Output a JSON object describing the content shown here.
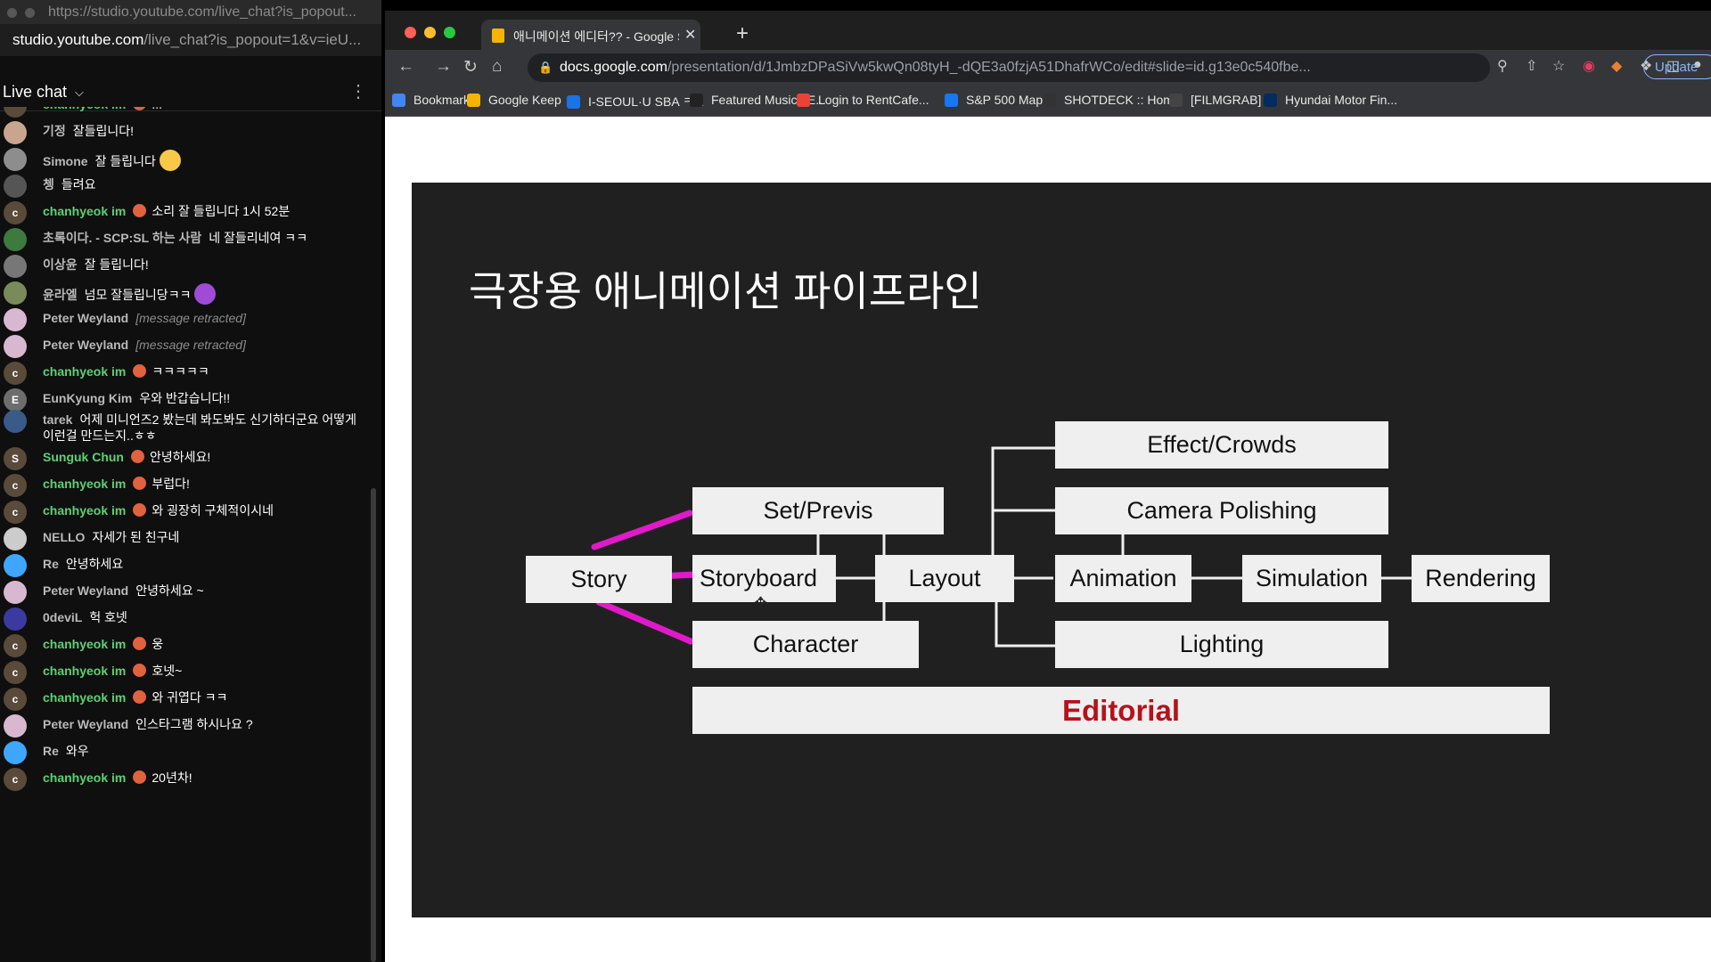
{
  "chat_window": {
    "title": "https://studio.youtube.com/live_chat?is_popout...",
    "url_host": "studio.youtube.com",
    "url_rest": "/live_chat?is_popout=1&v=ieU...",
    "header_title": "Live chat"
  },
  "chat_messages": [
    {
      "author": "chanhyeok im",
      "text": "...",
      "owner": true,
      "color": "#5a4a3a"
    },
    {
      "author": "기정",
      "text": "잘들립니다!",
      "color": "#c9a58f"
    },
    {
      "author": "Simone",
      "text": "잘 들립니다",
      "color": "#8d8d8d"
    },
    {
      "author": "쳉",
      "text": "들려요",
      "color": "#555"
    },
    {
      "author": "chanhyeok im",
      "text": "소리 잘 들립니다 1시 52분",
      "owner": true,
      "color": "#5a4a3a",
      "initial": "c"
    },
    {
      "author": "초록이다. - SCP:SL 하는 사람",
      "text": "네 잘들리네여 ㅋㅋ",
      "color": "#3d7a3d"
    },
    {
      "author": "이상윤",
      "text": "잘 들립니다!",
      "color": "#777"
    },
    {
      "author": "윤라엘",
      "text": "넘모 잘들립니당ㅋㅋ",
      "color": "#7a8a5a"
    },
    {
      "author": "Peter Weyland",
      "text": "[message retracted]",
      "retracted": true,
      "color": "#d8b8d0"
    },
    {
      "author": "Peter Weyland",
      "text": "[message retracted]",
      "retracted": true,
      "color": "#d8b8d0"
    },
    {
      "author": "chanhyeok im",
      "text": "ㅋㅋㅋㅋㅋ",
      "owner": true,
      "color": "#5a4a3a",
      "initial": "c"
    },
    {
      "author": "EunKyung Kim",
      "text": "우와 반갑습니다!!",
      "color": "#6d6d6d",
      "initial": "E"
    },
    {
      "author": "tarek",
      "text": "어제 미니언즈2 봤는데 봐도봐도 신기하더군요 어떻게 이런걸 만드는지..ㅎㅎ",
      "color": "#3a5a8a"
    },
    {
      "author": "Sunguk Chun",
      "text": "안녕하세요!",
      "owner": true,
      "color": "#5a4a3a",
      "initial": "S"
    },
    {
      "author": "chanhyeok im",
      "text": "부럽다!",
      "owner": true,
      "color": "#5a4a3a",
      "initial": "c"
    },
    {
      "author": "chanhyeok im",
      "text": "와 굉장히 구체적이시네",
      "owner": true,
      "color": "#5a4a3a",
      "initial": "c"
    },
    {
      "author": "NELLO",
      "text": "자세가 된 친구네",
      "color": "#ccc"
    },
    {
      "author": "Re",
      "text": "안녕하세요",
      "color": "#3ea6ff"
    },
    {
      "author": "Peter Weyland",
      "text": "안녕하세요 ~",
      "color": "#d8b8d0"
    },
    {
      "author": "0deviL",
      "text": "헉 호넷",
      "color": "#3a3aa0"
    },
    {
      "author": "chanhyeok im",
      "text": "웅",
      "owner": true,
      "color": "#5a4a3a",
      "initial": "c"
    },
    {
      "author": "chanhyeok im",
      "text": "호넷~",
      "owner": true,
      "color": "#5a4a3a",
      "initial": "c"
    },
    {
      "author": "chanhyeok im",
      "text": "와 귀엽다 ㅋㅋ",
      "owner": true,
      "color": "#5a4a3a",
      "initial": "c"
    },
    {
      "author": "Peter Weyland",
      "text": "인스타그램 하시나요 ?",
      "color": "#d8b8d0"
    },
    {
      "author": "Re",
      "text": "와우",
      "color": "#3ea6ff"
    },
    {
      "author": "chanhyeok im",
      "text": "20년차!",
      "owner": true,
      "color": "#5a4a3a",
      "initial": "c"
    }
  ],
  "browser": {
    "tab_title": "애니메이션 에디터?? - Google Slic",
    "url_host": "docs.google.com",
    "url_path": "/presentation/d/1JmbzDPaSiVw5kwQn08tyH_-dQE3a0fzjA51DhafrWCo/edit#slide=id.g13e0c540fbe...",
    "update_label": "Update",
    "bookmarks": [
      {
        "label": "Bookmarks",
        "color": "#4285f4"
      },
      {
        "label": "Google Keep",
        "color": "#f4b400"
      },
      {
        "label": "I-SEOUL·U SBA ㅋ...",
        "color": "#1a73e8"
      },
      {
        "label": "Featured Music | E...",
        "color": "#222"
      },
      {
        "label": "Login to RentCafe...",
        "color": "#ea4335"
      },
      {
        "label": "S&P 500 Map",
        "color": "#1877f2"
      },
      {
        "label": "SHOTDECK :: Home",
        "color": "#333"
      },
      {
        "label": "[FILMGRAB]",
        "color": "#444"
      },
      {
        "label": "Hyundai Motor Fin...",
        "color": "#002c5f"
      }
    ]
  },
  "slide": {
    "title": "극장용 애니메이션 파이프라인",
    "boxes": {
      "story": "Story",
      "set_previs": "Set/Previs",
      "storyboard": "Storyboard",
      "character": "Character",
      "layout": "Layout",
      "effect_crowds": "Effect/Crowds",
      "camera_polishing": "Camera Polishing",
      "animation": "Animation",
      "simulation": "Simulation",
      "rendering": "Rendering",
      "lighting": "Lighting",
      "editorial": "Editorial"
    },
    "annotation_color": "#e01ac8",
    "editorial_color": "#b5121b"
  }
}
